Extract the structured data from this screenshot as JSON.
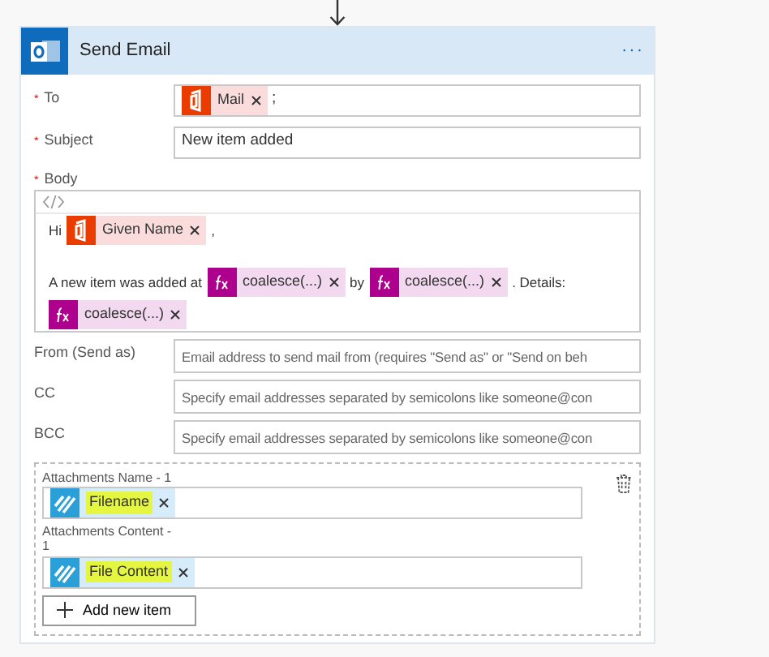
{
  "card": {
    "title": "Send Email",
    "menu": "···"
  },
  "fields": [
    {
      "label": "To",
      "required_mark": "*",
      "kind": "tokens",
      "tokens": [
        {
          "text": "Mail",
          "kind": "office",
          "highlighted": false
        }
      ],
      "suffix": ";"
    },
    {
      "label": "Subject",
      "required_mark": "*",
      "kind": "text",
      "value": "New item added"
    }
  ],
  "body": {
    "label": "Body",
    "required_mark": "*",
    "lines": [
      [
        {
          "kind": "text",
          "text": "Hi"
        },
        {
          "kind": "office",
          "text": "Given Name",
          "highlighted": false
        },
        {
          "kind": "text",
          "text": ","
        }
      ],
      [
        {
          "kind": "text",
          "text": "A new item was added at"
        },
        {
          "kind": "expression",
          "text": "coalesce(...)",
          "highlighted": false
        },
        {
          "kind": "text",
          "text": "by"
        },
        {
          "kind": "expression",
          "text": "coalesce(...)",
          "highlighted": false
        },
        {
          "kind": "text",
          "text": ". Details:"
        }
      ],
      [
        {
          "kind": "expression",
          "text": "coalesce(...)",
          "highlighted": false
        }
      ]
    ]
  },
  "optional_fields": [
    {
      "label": "From (Send as)",
      "placeholder": "Email address to send mail from (requires \"Send as\" or \"Send on beh"
    },
    {
      "label": "CC",
      "placeholder": "Specify email addresses separated by semicolons like someone@con"
    },
    {
      "label": "BCC",
      "placeholder": "Specify email addresses separated by semicolons like someone@con"
    }
  ],
  "attachments": {
    "items": [
      {
        "label": "Attachments Name - 1",
        "token": {
          "text": "Filename",
          "kind": "trigger",
          "highlighted": true
        }
      },
      {
        "label": "Attachments Content - 1",
        "token": {
          "text": "File Content",
          "kind": "trigger",
          "highlighted": true
        }
      }
    ],
    "add_button": "Add new item"
  }
}
